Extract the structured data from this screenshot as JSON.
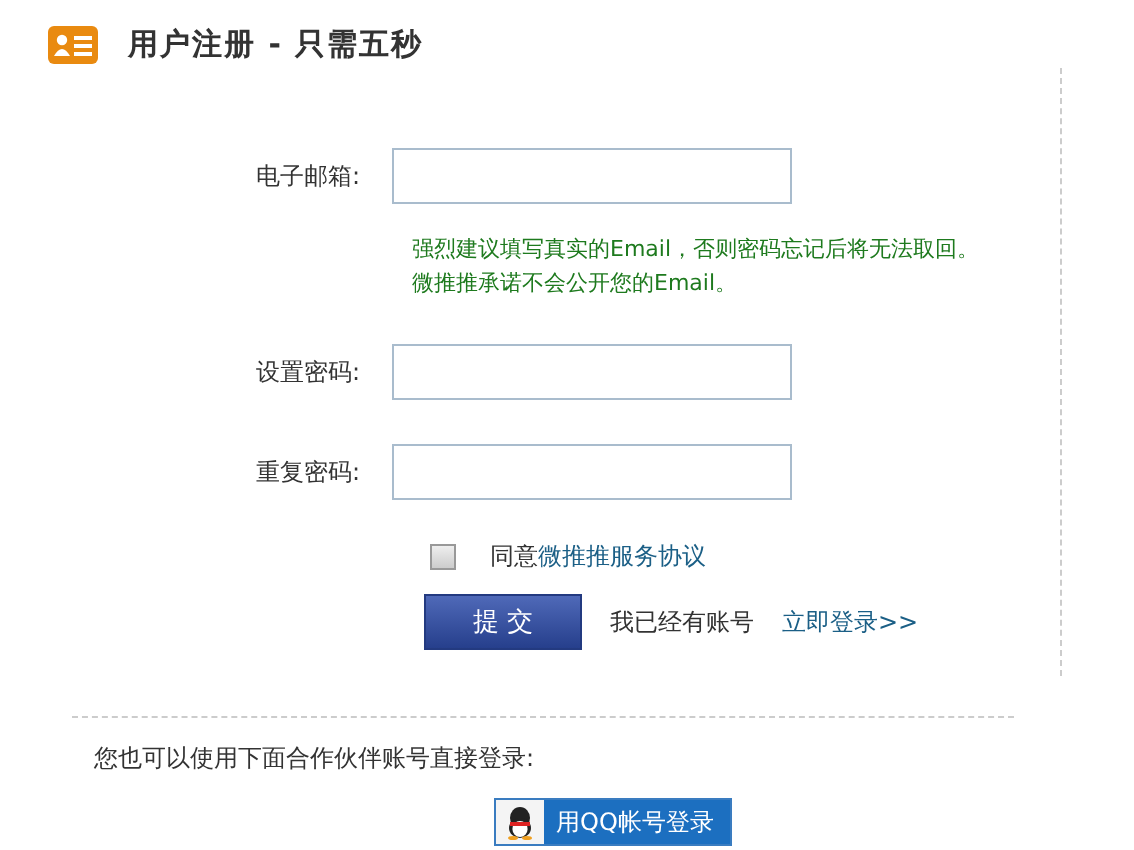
{
  "header": {
    "title": "用户注册 - 只需五秒"
  },
  "fields": [
    {
      "label": "电子邮箱:"
    },
    {
      "label": "设置密码:"
    },
    {
      "label": "重复密码:"
    }
  ],
  "email_hint": [
    "强烈建议填写真实的Email，否则密码忘记后将无法取回。",
    "微推推承诺不会公开您的Email。"
  ],
  "agreement": {
    "checked": false,
    "prefix": "同意",
    "link": "微推推服务协议"
  },
  "submit_button": "提 交",
  "have_account": "我已经有账号",
  "login_link": "立即登录>>",
  "partner_note": "您也可以使用下面合作伙伴账号直接登录:",
  "qq_button": "用QQ帐号登录"
}
